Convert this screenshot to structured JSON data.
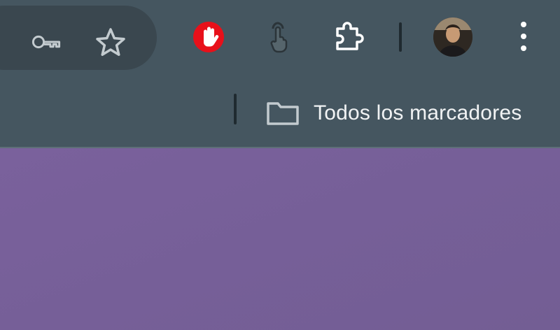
{
  "toolbar": {
    "omnibox_icons": [
      "key-icon",
      "star-icon"
    ],
    "extensions": [
      {
        "name": "adblock-extension",
        "icon": "hand-stop-icon",
        "color": "#e8101a"
      },
      {
        "name": "pointer-extension",
        "icon": "touch-pointer-icon",
        "color": "#2b3439"
      },
      {
        "name": "extensions-menu",
        "icon": "puzzle-icon",
        "color": "#ffffff"
      }
    ],
    "profile": {
      "icon": "avatar"
    },
    "menu": {
      "icon": "three-dots-vertical-icon"
    }
  },
  "bookmarks": {
    "all_bookmarks_label": "Todos los marcadores",
    "icon": "folder-icon"
  },
  "colors": {
    "chrome_background": "#455660",
    "omnibox_background": "#3a474f",
    "page_background": "#75609a"
  }
}
